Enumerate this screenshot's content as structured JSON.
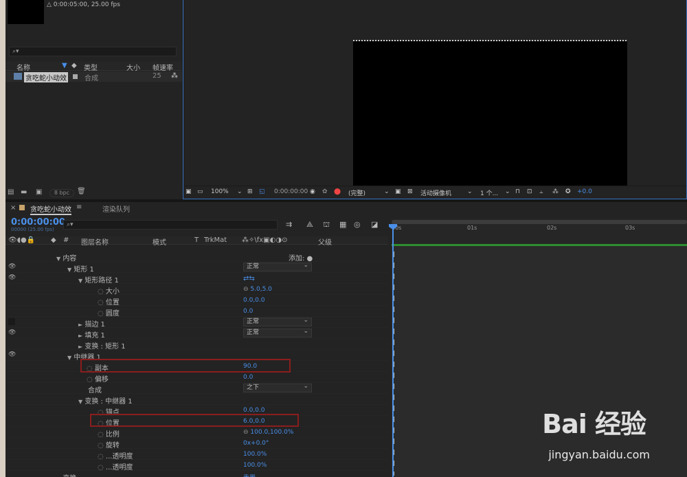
{
  "project": {
    "meta": "0:00:05:00, 25.00 fps",
    "columns": [
      "名称",
      "类型",
      "大小",
      "帧速率"
    ],
    "item": {
      "name": "贪吃蛇小动效",
      "type": "合成",
      "fps": "25"
    },
    "bpc": "8 bpc"
  },
  "viewer": {
    "zoom": "100%",
    "timecode": "0:00:00:00",
    "quality": "(完整)",
    "camera": "活动摄像机",
    "views": "1 个...",
    "exposure": "+0.0"
  },
  "timeline": {
    "tab_comp": "贪吃蛇小动效",
    "tab_render": "渲染队列",
    "timecode": "0:00:00:00",
    "fps": "00000 (25.00 fps)",
    "headers": {
      "hash": "#",
      "layer_name": "图层名称",
      "mode": "模式",
      "t": "T",
      "trkmat": "TrkMat",
      "parent": "父级"
    },
    "ruler": [
      "00s",
      "01s",
      "02s",
      "03s"
    ],
    "add_label": "添加:",
    "rows": [
      {
        "label": "内容"
      },
      {
        "label": "矩形 1",
        "mode": "正常"
      },
      {
        "label": "矩形路径 1"
      },
      {
        "label": "大小",
        "value": "5.0,5.0"
      },
      {
        "label": "位置",
        "value": "0.0,0.0"
      },
      {
        "label": "圆度",
        "value": "0.0"
      },
      {
        "label": "描边 1",
        "mode": "正常"
      },
      {
        "label": "填充 1",
        "mode": "正常"
      },
      {
        "label": "变换 : 矩形 1"
      },
      {
        "label": "中继器 1"
      },
      {
        "label": "副本",
        "value": "90.0"
      },
      {
        "label": "偏移",
        "value": "0.0"
      },
      {
        "label": "合成",
        "mode": "之下"
      },
      {
        "label": "变换 : 中继器 1"
      },
      {
        "label": "锚点",
        "value": "0.0,0.0"
      },
      {
        "label": "位置",
        "value": "6.0,0.0"
      },
      {
        "label": "比例",
        "value": "100.0,100.0%"
      },
      {
        "label": "旋转",
        "value": "0x+0.0°"
      },
      {
        "label": "...透明度",
        "value": "100.0%"
      },
      {
        "label": "...透明度",
        "value": "100.0%"
      },
      {
        "label": "变换",
        "value": "重置"
      }
    ]
  },
  "watermark": {
    "brand": "Bai 经验",
    "url": "jingyan.baidu.com"
  }
}
